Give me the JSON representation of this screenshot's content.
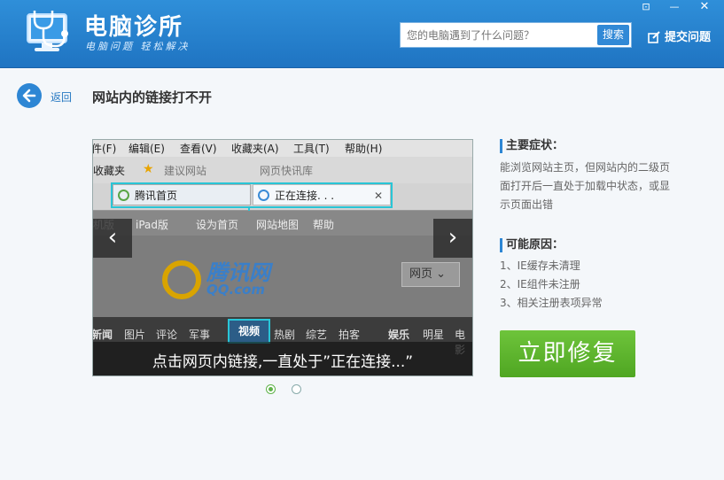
{
  "app": {
    "title": "电脑诊所",
    "slogan": "电脑问题 轻松解决",
    "window_controls": [
      "⊡",
      "—",
      "✕"
    ]
  },
  "search": {
    "placeholder": "您的电脑遇到了什么问题？",
    "button_label": "搜索"
  },
  "feedback_label": "提交问题",
  "back_label": "返回",
  "page_title": "网站内的链接打不开",
  "slide": {
    "menu": [
      "件(F)",
      "编辑(E)",
      "查看(V)",
      "收藏夹(A)",
      "工具(T)",
      "帮助(H)"
    ],
    "favbar": [
      "收藏夹",
      "建议网站",
      "网页快讯库"
    ],
    "tab1": "腾讯首页",
    "tab2": "正在连接. . .",
    "navrow": [
      "机版",
      "iPad版",
      "设为首页",
      "网站地图",
      "帮助"
    ],
    "logo_text": "腾讯网",
    "logo_sub": "QQ.com",
    "search_box": "网页",
    "channels_left": [
      "新闻",
      "图片",
      "评论",
      "军事"
    ],
    "channel_highlight": "视频",
    "channels_right": [
      "热剧",
      "综艺",
      "拍客",
      "娱乐",
      "明星",
      "电影"
    ],
    "caption": "点击网页内链接,一直处于”正在连接...”",
    "prev": "‹",
    "next": "›"
  },
  "symptoms": {
    "heading": "主要症状：",
    "text": "能浏览网站主页，但网站内的二级页面打开后一直处于加载中状态，或显示页面出错"
  },
  "causes": {
    "heading": "可能原因：",
    "items": [
      "1、IE缓存未清理",
      "2、IE组件未注册",
      "3、相关注册表项异常"
    ]
  },
  "fix_button": "立即修复",
  "colors": {
    "brand_blue": "#1f74c2",
    "fix_green": "#5cb52e",
    "accent_cyan": "#29c5d6"
  }
}
